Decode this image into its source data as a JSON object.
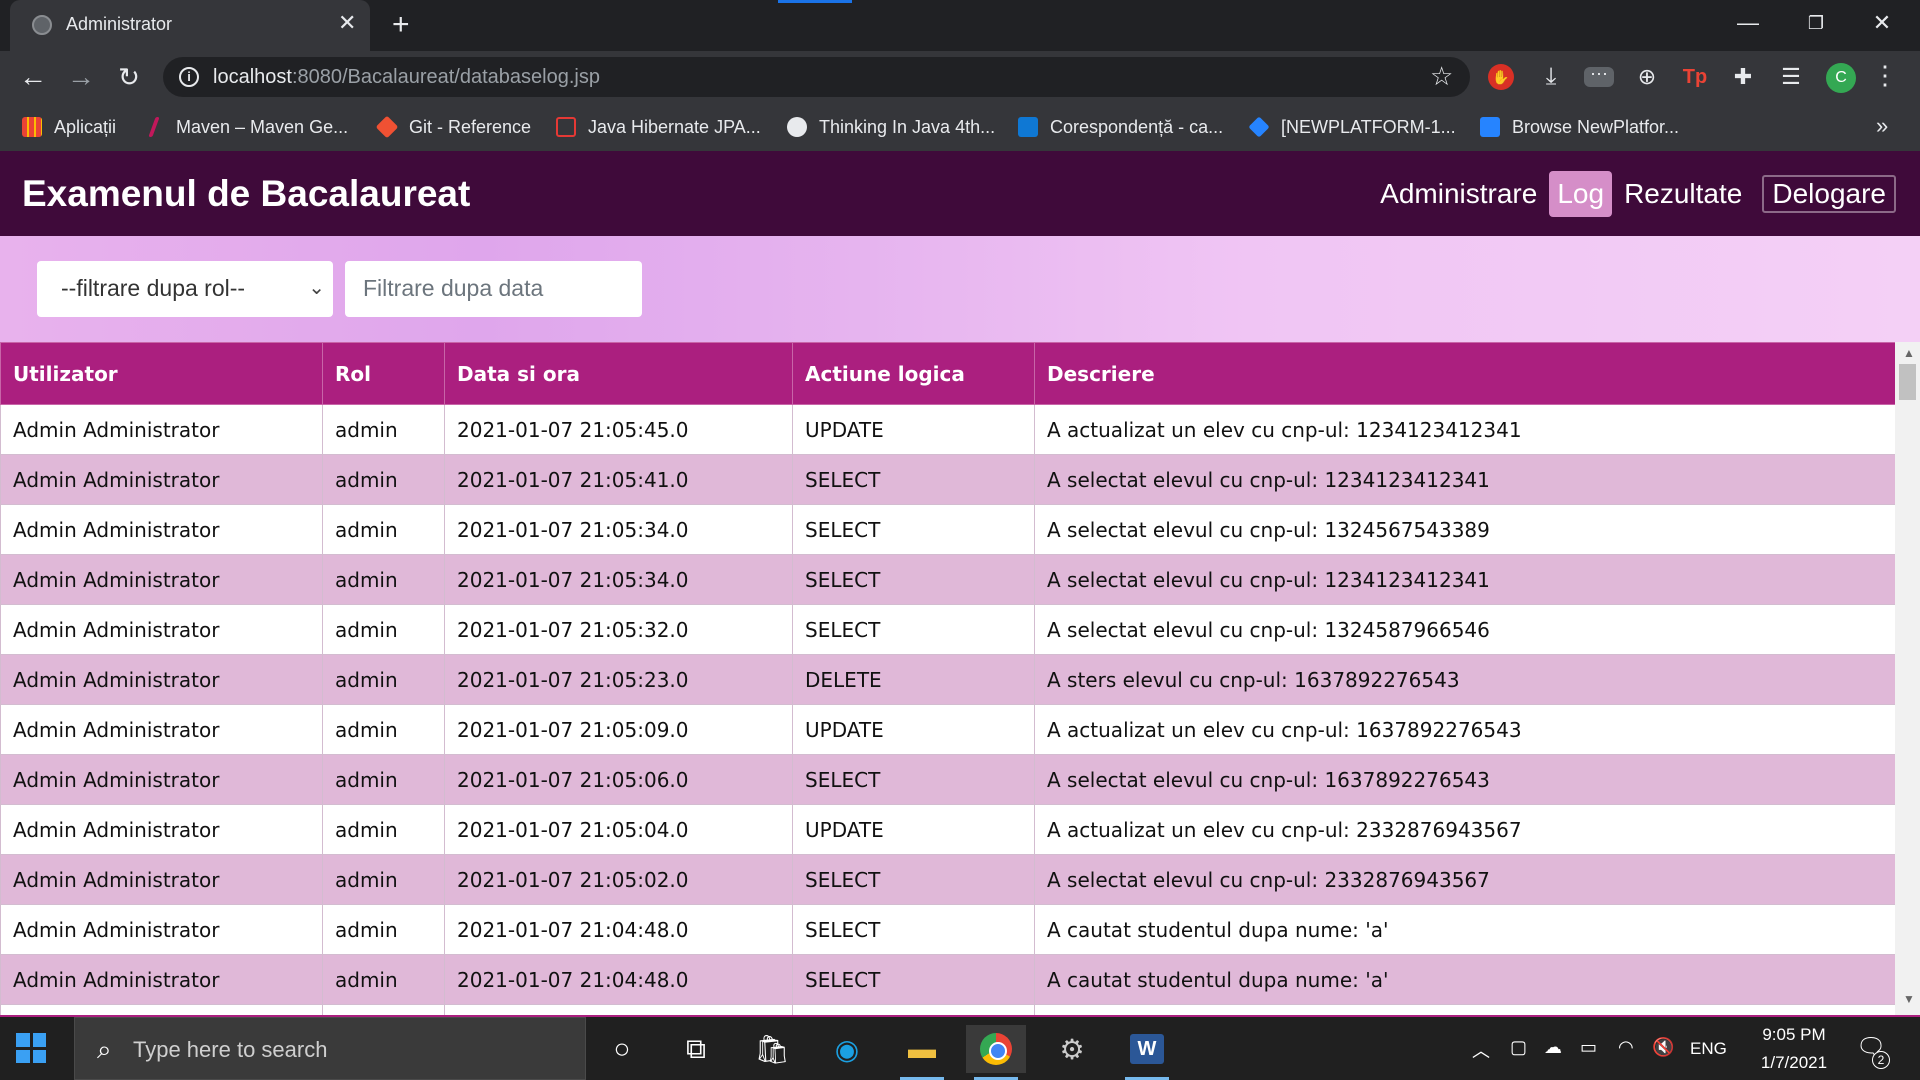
{
  "browser": {
    "tab_title": "Administrator",
    "tab_close": "✕",
    "new_tab": "+",
    "url_host": "localhost",
    "url_rest": ":8080/Bacalaureat/databaselog.jsp",
    "bookmarks": [
      {
        "label": "Aplicații",
        "icon": "apps-icon",
        "color": "#ea4335"
      },
      {
        "label": "Maven – Maven Ge...",
        "icon": "maven-icon",
        "color": "#c2185b"
      },
      {
        "label": "Git - Reference",
        "icon": "git-icon",
        "color": "#f05133"
      },
      {
        "label": "Java Hibernate JPA...",
        "icon": "java-icon",
        "color": "#e53935"
      },
      {
        "label": "Thinking In Java 4th...",
        "icon": "globe-icon",
        "color": "#e8eaed"
      },
      {
        "label": "Corespondență - ca...",
        "icon": "outlook-icon",
        "color": "#0f78d4"
      },
      {
        "label": "[NEWPLATFORM-1...",
        "icon": "jira-icon",
        "color": "#2684ff"
      },
      {
        "label": "Browse NewPlatfor...",
        "icon": "jira-board-icon",
        "color": "#2684ff"
      }
    ],
    "profile_initial": "C"
  },
  "app": {
    "title": "Examenul de Bacalaureat",
    "nav": {
      "administrare": "Administrare",
      "log": "Log",
      "rezultate": "Rezultate",
      "delogare": "Delogare"
    },
    "accent": "#3f0a3a",
    "active_nav": "#d58ec8"
  },
  "filters": {
    "role_selected": "--filtrare dupa rol--",
    "date_placeholder": "Filtrare dupa data"
  },
  "table": {
    "headers": [
      "Utilizator",
      "Rol",
      "Data si ora",
      "Actiune logica",
      "Descriere"
    ],
    "header_color": "#ab1f7f",
    "stripe_color": "#e0b8d8",
    "rows": [
      [
        "Admin Administrator",
        "admin",
        "2021-01-07 21:05:45.0",
        "UPDATE",
        "A actualizat un elev cu cnp-ul: 1234123412341"
      ],
      [
        "Admin Administrator",
        "admin",
        "2021-01-07 21:05:41.0",
        "SELECT",
        "A selectat elevul cu cnp-ul: 1234123412341"
      ],
      [
        "Admin Administrator",
        "admin",
        "2021-01-07 21:05:34.0",
        "SELECT",
        "A selectat elevul cu cnp-ul: 1324567543389"
      ],
      [
        "Admin Administrator",
        "admin",
        "2021-01-07 21:05:34.0",
        "SELECT",
        "A selectat elevul cu cnp-ul: 1234123412341"
      ],
      [
        "Admin Administrator",
        "admin",
        "2021-01-07 21:05:32.0",
        "SELECT",
        "A selectat elevul cu cnp-ul: 1324587966546"
      ],
      [
        "Admin Administrator",
        "admin",
        "2021-01-07 21:05:23.0",
        "DELETE",
        "A sters elevul cu cnp-ul: 1637892276543"
      ],
      [
        "Admin Administrator",
        "admin",
        "2021-01-07 21:05:09.0",
        "UPDATE",
        "A actualizat un elev cu cnp-ul: 1637892276543"
      ],
      [
        "Admin Administrator",
        "admin",
        "2021-01-07 21:05:06.0",
        "SELECT",
        "A selectat elevul cu cnp-ul: 1637892276543"
      ],
      [
        "Admin Administrator",
        "admin",
        "2021-01-07 21:05:04.0",
        "UPDATE",
        "A actualizat un elev cu cnp-ul: 2332876943567"
      ],
      [
        "Admin Administrator",
        "admin",
        "2021-01-07 21:05:02.0",
        "SELECT",
        "A selectat elevul cu cnp-ul: 2332876943567"
      ],
      [
        "Admin Administrator",
        "admin",
        "2021-01-07 21:04:48.0",
        "SELECT",
        "A cautat studentul dupa nume: 'a'"
      ],
      [
        "Admin Administrator",
        "admin",
        "2021-01-07 21:04:48.0",
        "SELECT",
        "A cautat studentul dupa nume: 'a'"
      ],
      [
        "",
        "",
        "",
        "",
        ""
      ]
    ]
  },
  "taskbar": {
    "search_placeholder": "Type here to search",
    "lang": "ENG",
    "time": "9:05 PM",
    "date": "1/7/2021",
    "notifications": "2"
  }
}
